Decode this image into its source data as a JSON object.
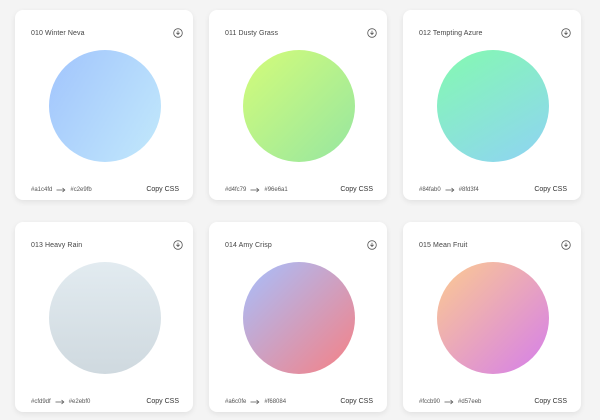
{
  "cards": [
    {
      "title": "010 Winter Neva",
      "from": "#a1c4fd",
      "to": "#c2e9fb",
      "from_color": "#a1c4fd",
      "to_color": "#c2e9fb",
      "copy_label": "Copy CSS"
    },
    {
      "title": "011 Dusty Grass",
      "from": "#d4fc79",
      "to": "#96e6a1",
      "from_color": "#d4fc79",
      "to_color": "#96e6a1",
      "copy_label": "Copy CSS"
    },
    {
      "title": "012 Tempting Azure",
      "from": "#84fab0",
      "to": "#8fd3f4",
      "from_color": "#84fab0",
      "to_color": "#8fd3f4",
      "copy_label": "Copy CSS"
    },
    {
      "title": "013 Heavy Rain",
      "from": "#cfd9df",
      "to": "#e2ebf0",
      "from_color": "#cfd9df",
      "to_color": "#e2ebf0",
      "copy_label": "Copy CSS"
    },
    {
      "title": "014 Amy Crisp",
      "from": "#a6c0fe",
      "to": "#f68084",
      "from_color": "#a6c0fe",
      "to_color": "#f68084",
      "copy_label": "Copy CSS"
    },
    {
      "title": "015 Mean Fruit",
      "from": "#fccb90",
      "to": "#d57eeb",
      "from_color": "#fccb90",
      "to_color": "#d57eeb",
      "copy_label": "Copy CSS"
    }
  ],
  "icons": {
    "download": "download-icon",
    "arrow": "right-arrow-icon"
  },
  "colors": {
    "background": "#f4f4f4",
    "card": "#ffffff"
  }
}
